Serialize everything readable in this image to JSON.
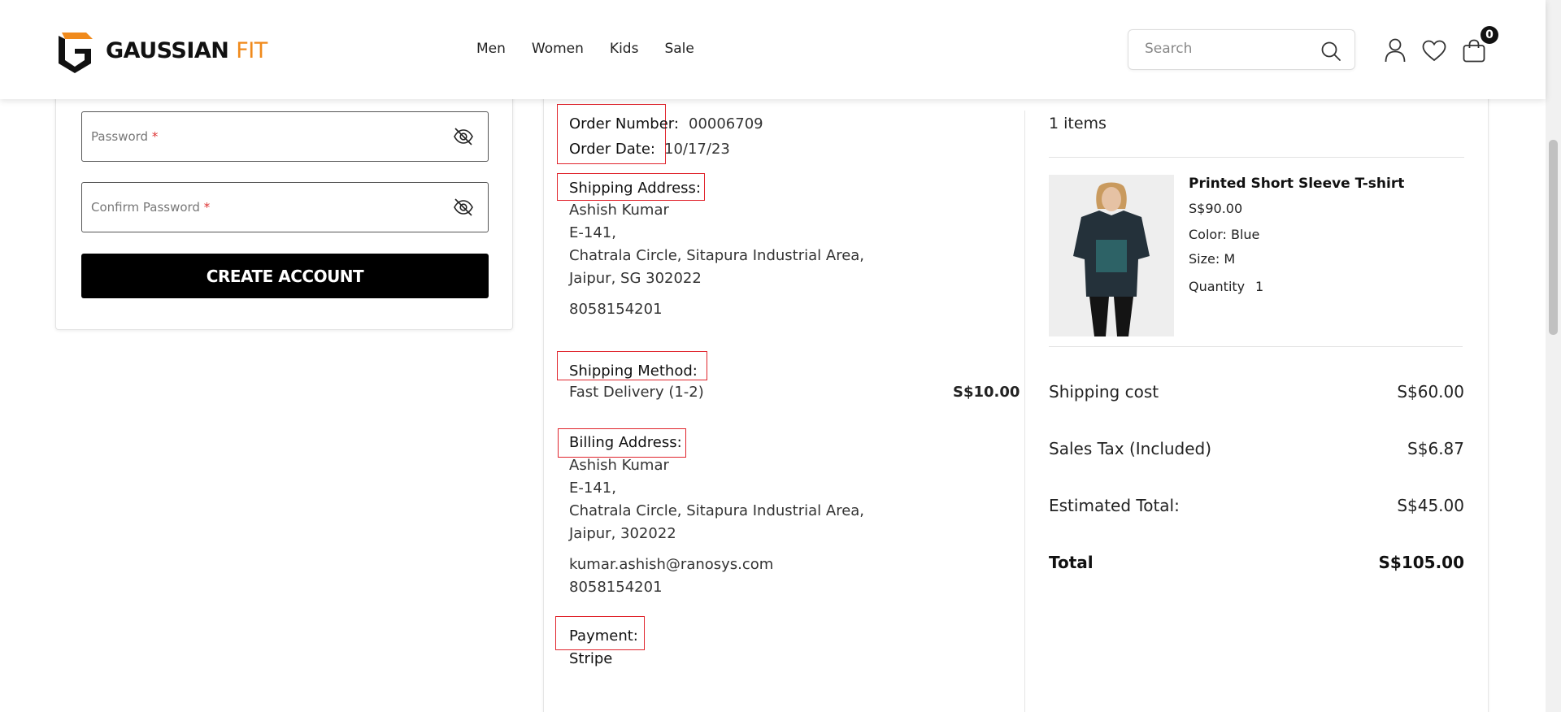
{
  "header": {
    "logo": {
      "brand": "GAUSSIAN",
      "accent": "FIT"
    },
    "nav": [
      "Men",
      "Women",
      "Kids",
      "Sale"
    ],
    "search_placeholder": "Search",
    "cart_count": "0"
  },
  "form": {
    "password_label": "Password",
    "confirm_label": "Confirm Password",
    "required_mark": "*",
    "create_button": "CREATE ACCOUNT"
  },
  "order": {
    "order_number_label": "Order Number:",
    "order_number": "00006709",
    "order_date_label": "Order Date:",
    "order_date": "10/17/23",
    "shipping_address_label": "Shipping Address:",
    "shipping_address": {
      "name": "Ashish Kumar",
      "line1": "E-141,",
      "line2": "Chatrala Circle, Sitapura Industrial Area,",
      "line3": "Jaipur, SG 302022",
      "phone": "8058154201"
    },
    "shipping_method_label": "Shipping Method:",
    "shipping_method": "Fast Delivery (1-2)",
    "shipping_method_price": "S$10.00",
    "billing_address_label": "Billing Address:",
    "billing_address": {
      "name": "Ashish Kumar",
      "line1": "E-141,",
      "line2": "Chatrala Circle, Sitapura Industrial Area,",
      "line3": "Jaipur, 302022",
      "email": "kumar.ashish@ranosys.com",
      "phone": "8058154201"
    },
    "payment_label": "Payment:",
    "payment": "Stripe"
  },
  "summary": {
    "items_count": "1 items",
    "product": {
      "name": "Printed Short Sleeve T-shirt",
      "price": "S$90.00",
      "color": "Color: Blue",
      "size": "Size: M",
      "quantity_label": "Quantity",
      "quantity": "1"
    },
    "shipping_cost_label": "Shipping cost",
    "shipping_cost": "S$60.00",
    "sales_tax_label": "Sales Tax (Included)",
    "sales_tax": "S$6.87",
    "estimated_total_label": "Estimated Total:",
    "estimated_total": "S$45.00",
    "total_label": "Total",
    "total": "S$105.00"
  },
  "colors": {
    "accent": "#f08a1c",
    "highlight_box": "#e0242c",
    "button_bg": "#000000"
  },
  "icons": [
    "logo-g-icon",
    "search-icon",
    "user-icon",
    "heart-icon",
    "bag-icon",
    "eye-off-icon"
  ]
}
